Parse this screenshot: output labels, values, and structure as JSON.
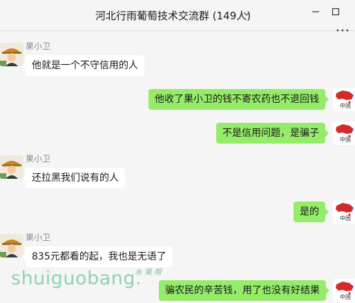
{
  "window": {
    "title": "河北行雨葡萄技术交流群 (149人)",
    "title_chevron_icon": "chevron-down-icon",
    "minimize_icon": "minimize-icon",
    "maximize_icon": "maximize-icon",
    "more_icon": "more-icon"
  },
  "colors": {
    "outgoing_bubble": "#95ec69",
    "incoming_bubble": "#ffffff",
    "background": "#f5f5f5",
    "sender_name": "#8c8c8c",
    "watermark": "#8fd3ae"
  },
  "messages": [
    {
      "direction": "in",
      "sender": "果小卫",
      "text": "他就是一个不守信用的人"
    },
    {
      "direction": "out",
      "text": "他收了果小卫的钱不寄农药也不退回钱"
    },
    {
      "direction": "out",
      "text": "不是信用问题，是骗子"
    },
    {
      "direction": "in",
      "sender": "果小卫",
      "text": "还拉黑我们说有的人"
    },
    {
      "direction": "out",
      "text": "是的"
    },
    {
      "direction": "in",
      "sender": "果小卫",
      "text": "835元都看的起，我也是无语了"
    },
    {
      "direction": "out",
      "text": "骗农民的辛苦钱，用了也没有好结果"
    }
  ],
  "avatars": {
    "incoming_icon": "farmer-avatar-icon",
    "outgoing_icon": "china-map-avatar-icon",
    "outgoing_text": "中国"
  },
  "watermark": {
    "text": "shuiguobang.",
    "text_cn": "水果帮"
  }
}
